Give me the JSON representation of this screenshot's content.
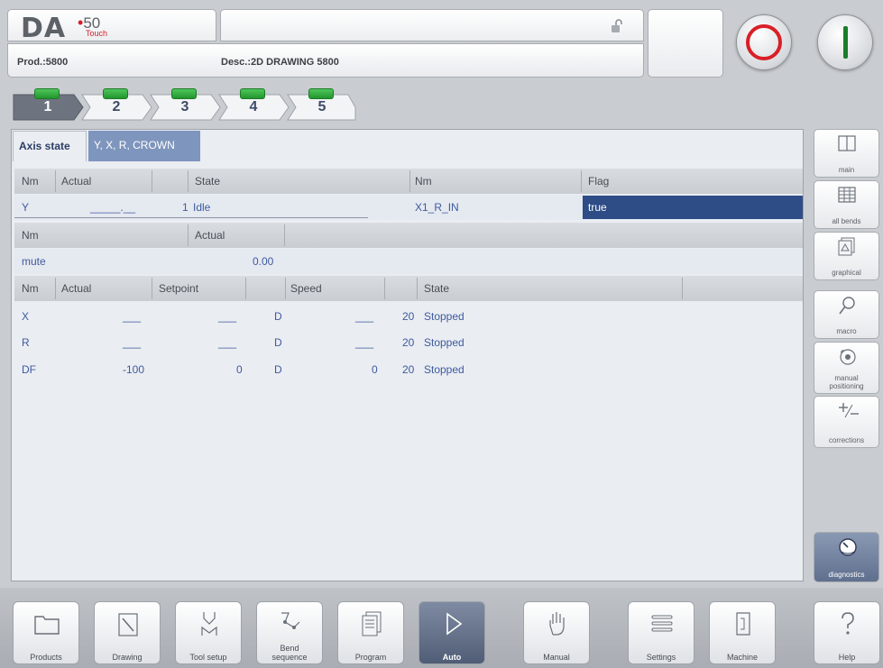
{
  "header": {
    "logo_text": "DA",
    "logo_number": "50",
    "logo_touch": "Touch",
    "product": "Prod.:5800",
    "description": "Desc.:2D DRAWING 5800",
    "colors": {
      "stop": "#d91f26",
      "start": "#1a7d2a",
      "accent": "#2e4c86"
    }
  },
  "bend_steps": [
    {
      "number": "1",
      "active": true
    },
    {
      "number": "2",
      "active": false
    },
    {
      "number": "3",
      "active": false
    },
    {
      "number": "4",
      "active": false
    },
    {
      "number": "5",
      "active": false
    }
  ],
  "tabs": {
    "axis_state": "Axis state",
    "yxr_crown": "Y, X, R, CROWN"
  },
  "table1": {
    "headers": {
      "nm": "Nm",
      "actual": "Actual",
      "state": "State",
      "nm2": "Nm",
      "flag": "Flag"
    },
    "row": {
      "nm": "Y",
      "actual": "_____.__",
      "num": "1",
      "state": "Idle",
      "nm2": "X1_R_IN",
      "flag": "true"
    }
  },
  "table2": {
    "headers": {
      "nm": "Nm",
      "actual": "Actual"
    },
    "row": {
      "nm": "mute",
      "actual": "0.00"
    }
  },
  "table3": {
    "headers": {
      "nm": "Nm",
      "actual": "Actual",
      "setpoint": "Setpoint",
      "speed": "Speed",
      "state": "State"
    },
    "rows": [
      {
        "nm": "X",
        "actual": "___",
        "setpoint": "___",
        "d": "D",
        "speed": "___",
        "num": "20",
        "state": "Stopped"
      },
      {
        "nm": "R",
        "actual": "___",
        "setpoint": "___",
        "d": "D",
        "speed": "___",
        "num": "20",
        "state": "Stopped"
      },
      {
        "nm": "DF",
        "actual": "-100",
        "setpoint": "0",
        "d": "D",
        "speed": "0",
        "num": "20",
        "state": "Stopped"
      }
    ]
  },
  "sidebar": [
    {
      "label": "main",
      "icon": "split-panel-icon"
    },
    {
      "label": "all bends",
      "icon": "table-grid-icon"
    },
    {
      "label": "graphical",
      "icon": "graphical-icon"
    },
    {
      "label": "macro",
      "icon": "magnifier-icon"
    },
    {
      "label": "manual",
      "label2": "positioning",
      "icon": "manual-positioning-icon"
    },
    {
      "label": "corrections",
      "icon": "plus-minus-icon"
    },
    {
      "label": "diagnostics",
      "icon": "gauge-icon"
    }
  ],
  "toolbar": [
    {
      "label": "Products",
      "icon": "folder-icon"
    },
    {
      "label": "Drawing",
      "icon": "drawing-icon"
    },
    {
      "label": "Tool setup",
      "icon": "tool-icon"
    },
    {
      "label": "Bend",
      "label2": "sequence",
      "icon": "bend-sequence-icon"
    },
    {
      "label": "Program",
      "icon": "program-icon"
    },
    {
      "label": "Auto",
      "icon": "play-icon"
    },
    {
      "label": "Manual",
      "icon": "hand-icon"
    },
    {
      "label": "Settings",
      "icon": "settings-list-icon"
    },
    {
      "label": "Machine",
      "icon": "machine-icon"
    },
    {
      "label": "Help",
      "icon": "question-icon"
    }
  ]
}
